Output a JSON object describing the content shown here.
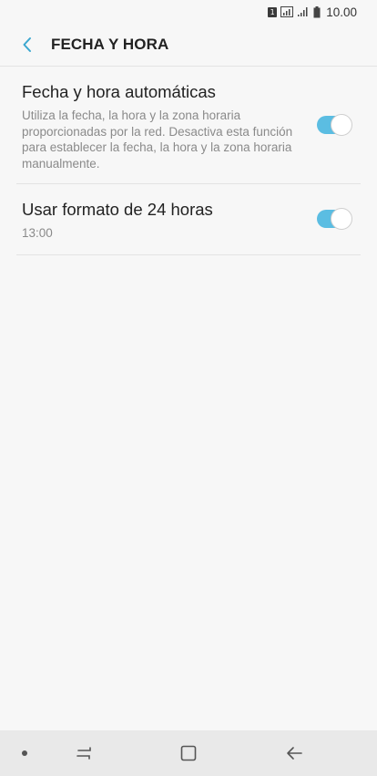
{
  "status_bar": {
    "sim_slot": "1",
    "time": "10.00"
  },
  "header": {
    "title": "FECHA Y HORA"
  },
  "settings": [
    {
      "title": "Fecha y hora automáticas",
      "description": "Utiliza la fecha, la hora y la zona horaria proporcionadas por la red. Desactiva esta función para establecer la fecha, la hora y la zona horaria manualmente.",
      "enabled": true
    },
    {
      "title": "Usar formato de 24 horas",
      "subtitle": "13:00",
      "enabled": true
    }
  ],
  "colors": {
    "accent": "#5bbde2",
    "background": "#f7f7f7"
  },
  "nav_bar": {
    "icons": [
      "dot-icon",
      "recent-apps-icon",
      "home-icon",
      "back-icon"
    ]
  }
}
